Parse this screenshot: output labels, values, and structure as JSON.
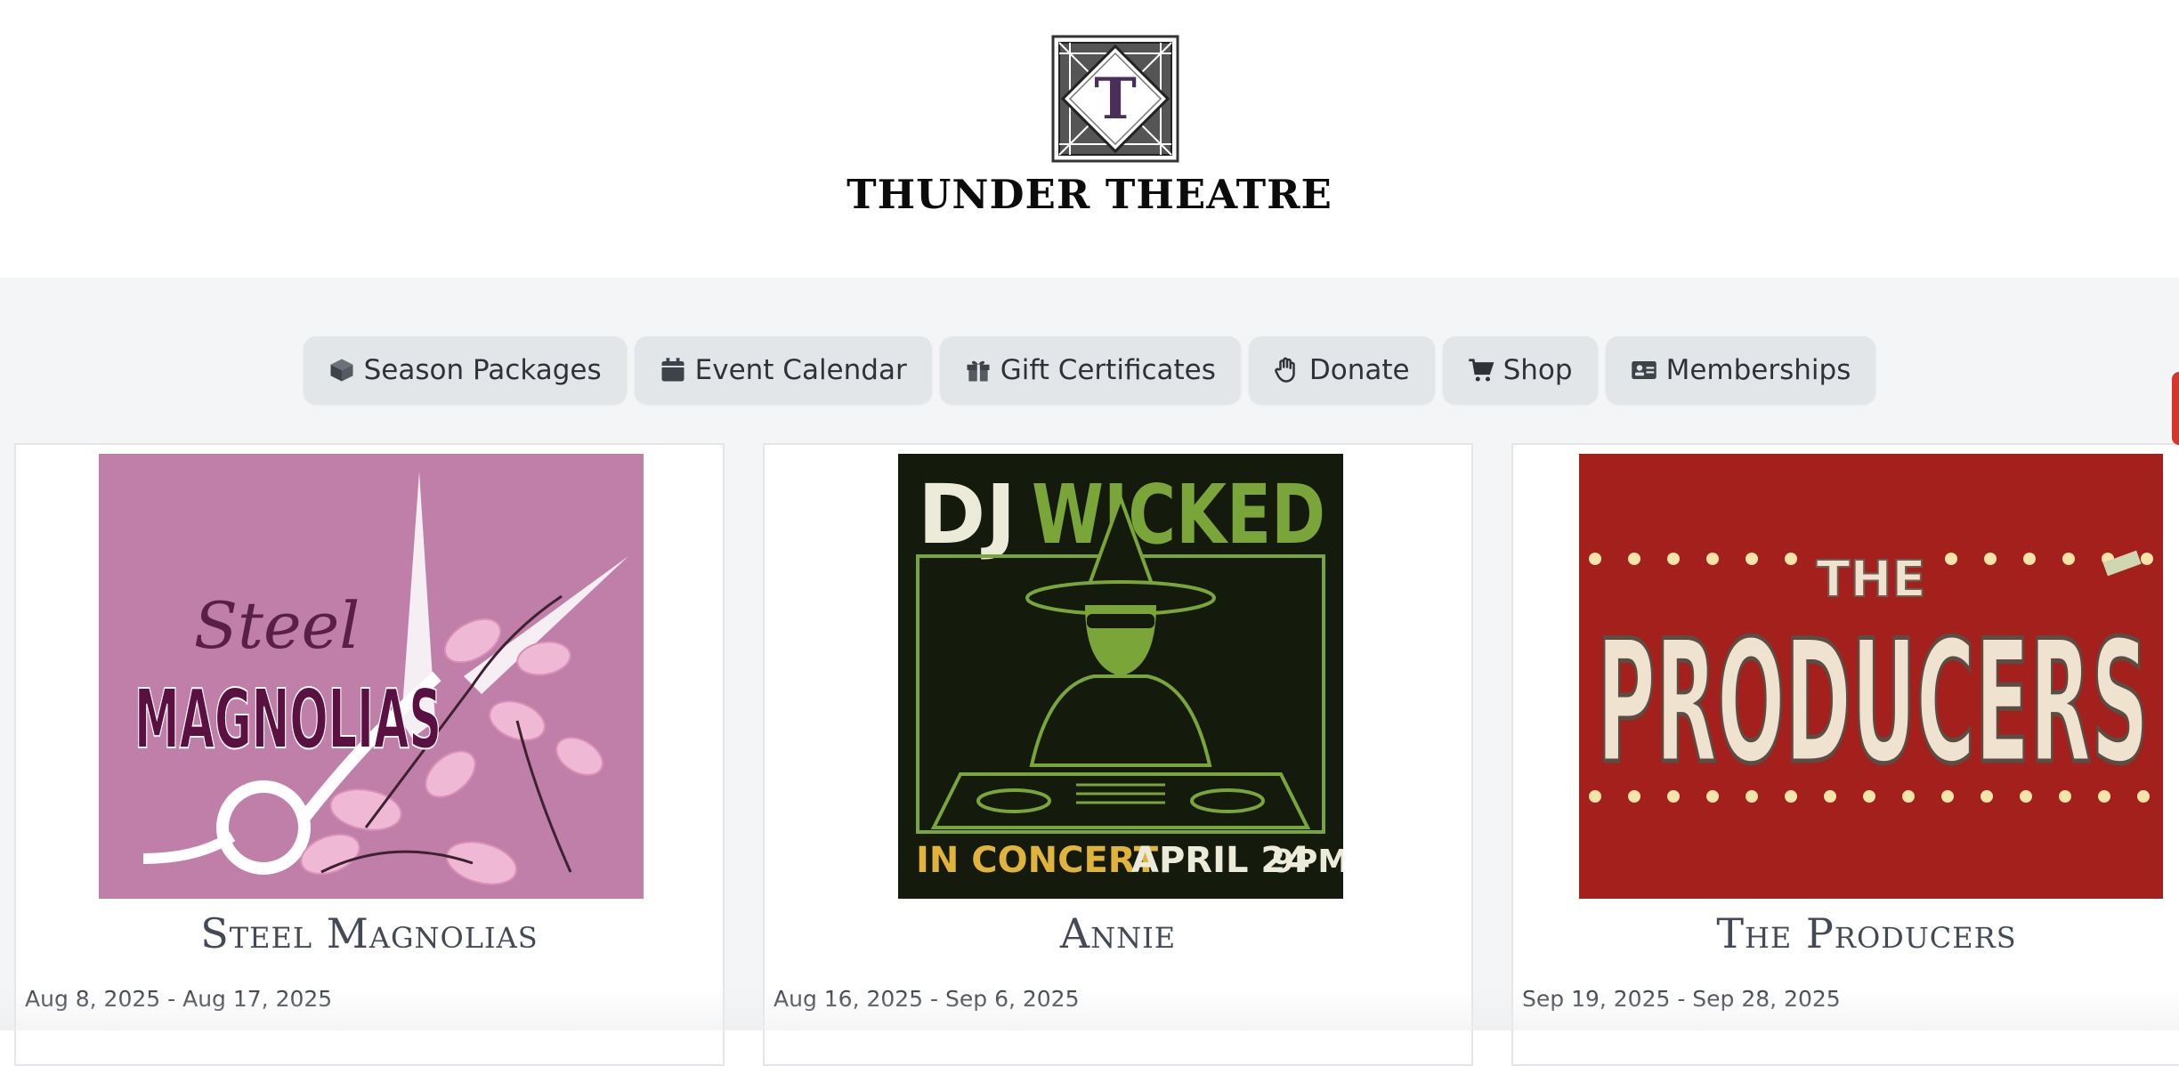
{
  "site": {
    "name": "THUNDER THEATRE",
    "logo_letter": "T"
  },
  "nav": [
    {
      "label": "Season Packages",
      "icon": "box-icon"
    },
    {
      "label": "Event Calendar",
      "icon": "calendar-icon"
    },
    {
      "label": "Gift Certificates",
      "icon": "gift-icon"
    },
    {
      "label": "Donate",
      "icon": "hand-icon"
    },
    {
      "label": "Shop",
      "icon": "cart-icon"
    },
    {
      "label": "Memberships",
      "icon": "id-card-icon"
    }
  ],
  "events": [
    {
      "title": "Steel Magnolias",
      "dates": "Aug 8, 2025 - Aug 17, 2025",
      "poster": {
        "script_word": "Steel",
        "main_word": "MAGNOLIAS",
        "bg": "#c07fa8"
      }
    },
    {
      "title": "Annie",
      "dates": "Aug 16, 2025 - Sep 6, 2025",
      "poster": {
        "word1": "DJ",
        "word2": "WICKED",
        "line_a": "IN CONCERT",
        "line_b": "APRIL 24",
        "line_c": "9PM",
        "bg": "#141a0c"
      }
    },
    {
      "title": "The Producers",
      "dates": "Sep 19, 2025 - Sep 28, 2025",
      "poster": {
        "small": "THE",
        "main": "PRODUCERS",
        "bg": "#a3201d"
      }
    }
  ],
  "colors": {
    "accent": "#d9342b",
    "nav_bg": "#e3e6e9"
  }
}
